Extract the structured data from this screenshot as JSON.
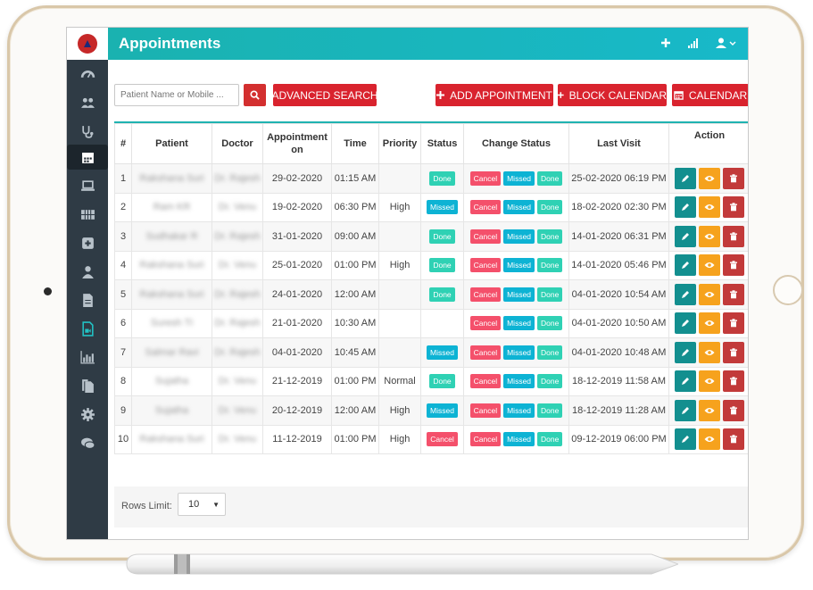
{
  "app": {
    "title": "Appointments"
  },
  "toolbar": {
    "search_placeholder": "Patient Name or Mobile ...",
    "advanced_search": "ADVANCED SEARCH",
    "add_appointment": "ADD APPOINTMENT",
    "block_calendar": "BLOCK CALENDAR",
    "calendar": "CALENDAR"
  },
  "table": {
    "headers": [
      "#",
      "Patient",
      "Doctor",
      "Appointment on",
      "Time",
      "Priority",
      "Status",
      "Change Status",
      "Last Visit",
      "Action"
    ],
    "change_status_labels": {
      "cancel": "Cancel",
      "missed": "Missed",
      "done": "Done"
    },
    "rows": [
      {
        "num": "1",
        "patient": "Rakshana Suri",
        "doctor": "Dr. Rajesh",
        "date": "29-02-2020",
        "time": "01:15 AM",
        "priority": "",
        "status": "Done",
        "last_visit": "25-02-2020 06:19 PM"
      },
      {
        "num": "2",
        "patient": "Ram KR",
        "doctor": "Dr. Venu",
        "date": "19-02-2020",
        "time": "06:30 PM",
        "priority": "High",
        "status": "Missed",
        "last_visit": "18-02-2020 02:30 PM"
      },
      {
        "num": "3",
        "patient": "Sudhakar R",
        "doctor": "Dr. Rajesh",
        "date": "31-01-2020",
        "time": "09:00 AM",
        "priority": "",
        "status": "Done",
        "last_visit": "14-01-2020 06:31 PM"
      },
      {
        "num": "4",
        "patient": "Rakshana Suri",
        "doctor": "Dr. Venu",
        "date": "25-01-2020",
        "time": "01:00 PM",
        "priority": "High",
        "status": "Done",
        "last_visit": "14-01-2020 05:46 PM"
      },
      {
        "num": "5",
        "patient": "Rakshana Suri",
        "doctor": "Dr. Rajesh",
        "date": "24-01-2020",
        "time": "12:00 AM",
        "priority": "",
        "status": "Done",
        "last_visit": "04-01-2020 10:54 AM"
      },
      {
        "num": "6",
        "patient": "Suresh TI",
        "doctor": "Dr. Rajesh",
        "date": "21-01-2020",
        "time": "10:30 AM",
        "priority": "",
        "status": "",
        "last_visit": "04-01-2020 10:50 AM"
      },
      {
        "num": "7",
        "patient": "Salmar Ravi",
        "doctor": "Dr. Rajesh",
        "date": "04-01-2020",
        "time": "10:45 AM",
        "priority": "",
        "status": "Missed",
        "last_visit": "04-01-2020 10:48 AM"
      },
      {
        "num": "8",
        "patient": "Sujatha",
        "doctor": "Dr. Venu",
        "date": "21-12-2019",
        "time": "01:00 PM",
        "priority": "Normal",
        "status": "Done",
        "last_visit": "18-12-2019 11:58 AM"
      },
      {
        "num": "9",
        "patient": "Sujatha",
        "doctor": "Dr. Venu",
        "date": "20-12-2019",
        "time": "12:00 AM",
        "priority": "High",
        "status": "Missed",
        "last_visit": "18-12-2019 11:28 AM"
      },
      {
        "num": "10",
        "patient": "Rakshana Suri",
        "doctor": "Dr. Venu",
        "date": "11-12-2019",
        "time": "01:00 PM",
        "priority": "High",
        "status": "Cancel",
        "last_visit": "09-12-2019 06:00 PM"
      }
    ]
  },
  "footer": {
    "rows_limit_label": "Rows Limit:",
    "rows_limit_value": "10"
  },
  "colors": {
    "header": "#1ab2b0",
    "sidebar": "#2f3b45",
    "red_button": "#d9232e",
    "done": "#2fd1b4",
    "missed": "#0db3d4",
    "cancel": "#f4506b",
    "edit": "#138f8f",
    "view": "#f6a21d",
    "delete": "#c23a3a"
  },
  "sidebar_icons": [
    "dashboard-icon",
    "users-icon",
    "stethoscope-icon",
    "calendar-icon",
    "laptop-icon",
    "grid-icon",
    "plus-square-icon",
    "user-icon",
    "file-icon",
    "file-video-icon",
    "bar-chart-icon",
    "files-icon",
    "gear-icon",
    "chat-icon"
  ]
}
